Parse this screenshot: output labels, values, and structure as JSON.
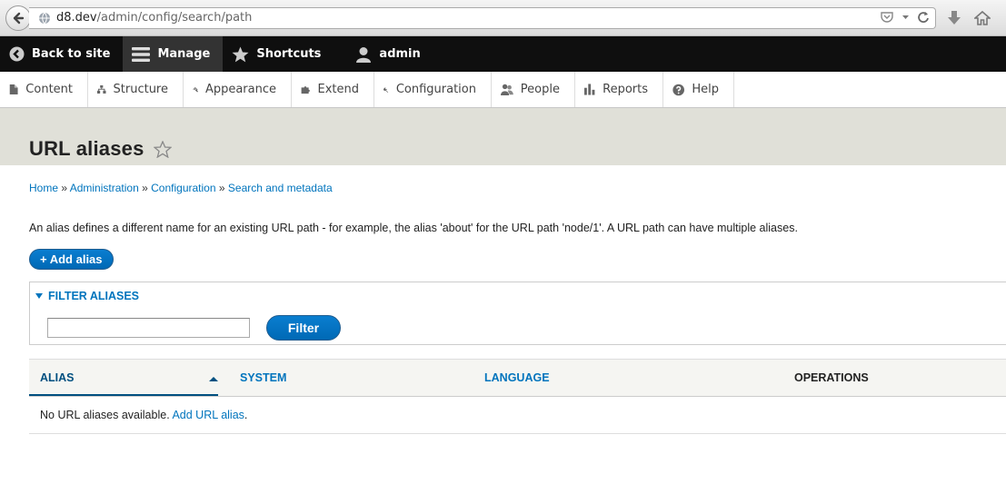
{
  "browser": {
    "url_host": "d8.dev",
    "url_path": "/admin/config/search/path"
  },
  "toolbar": {
    "back_to_site": "Back to site",
    "manage": "Manage",
    "shortcuts": "Shortcuts",
    "user": "admin"
  },
  "tray": {
    "items": [
      {
        "label": "Content",
        "icon": "file-icon"
      },
      {
        "label": "Structure",
        "icon": "structure-icon"
      },
      {
        "label": "Appearance",
        "icon": "paintbrush-icon"
      },
      {
        "label": "Extend",
        "icon": "puzzle-icon"
      },
      {
        "label": "Configuration",
        "icon": "wrench-icon"
      },
      {
        "label": "People",
        "icon": "people-icon"
      },
      {
        "label": "Reports",
        "icon": "bar-chart-icon"
      },
      {
        "label": "Help",
        "icon": "help-icon"
      }
    ]
  },
  "page": {
    "title": "URL aliases",
    "breadcrumb": [
      "Home",
      "Administration",
      "Configuration",
      "Search and metadata"
    ],
    "breadcrumb_sep": "»",
    "description": "An alias defines a different name for an existing URL path - for example, the alias 'about' for the URL path 'node/1'. A URL path can have multiple aliases.",
    "add_button": "+ Add alias"
  },
  "filter": {
    "legend": "FILTER ALIASES",
    "input_value": "",
    "button": "Filter"
  },
  "table": {
    "headers": [
      "ALIAS",
      "SYSTEM",
      "LANGUAGE",
      "OPERATIONS"
    ],
    "empty_text": "No URL aliases available.",
    "empty_link": "Add URL alias",
    "empty_suffix": "."
  },
  "colors": {
    "link": "#0074bd",
    "toolbar_bg": "#0f0f0f",
    "header_bg": "#e0e0d8",
    "button_bg": "#0071c2"
  }
}
